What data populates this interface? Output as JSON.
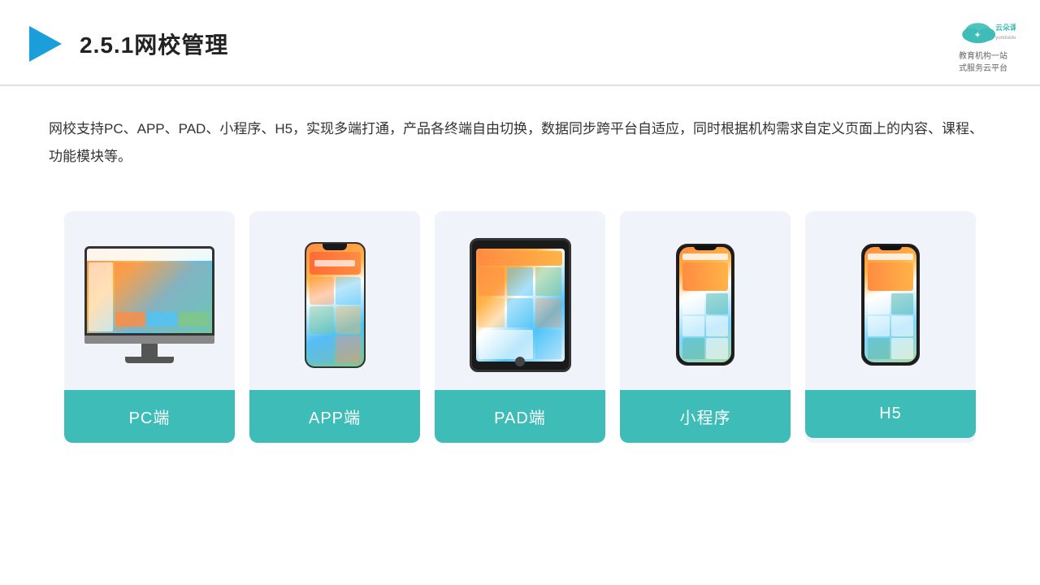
{
  "header": {
    "title": "2.5.1网校管理",
    "logo_name": "云朵课堂",
    "logo_url": "yunduoketang.com",
    "logo_tagline1": "教育机构一站",
    "logo_tagline2": "式服务云平台"
  },
  "description": {
    "text": "网校支持PC、APP、PAD、小程序、H5，实现多端打通，产品各终端自由切换，数据同步跨平台自适应，同时根据机构需求自定义页面上的内容、课程、功能模块等。"
  },
  "cards": [
    {
      "id": "pc",
      "label": "PC端"
    },
    {
      "id": "app",
      "label": "APP端"
    },
    {
      "id": "pad",
      "label": "PAD端"
    },
    {
      "id": "miniprogram",
      "label": "小程序"
    },
    {
      "id": "h5",
      "label": "H5"
    }
  ],
  "colors": {
    "teal": "#3dbcb8",
    "accent_orange": "#ff8c42",
    "bg_card": "#eef2f8",
    "text_dark": "#333333",
    "border": "#e0e0e0"
  }
}
